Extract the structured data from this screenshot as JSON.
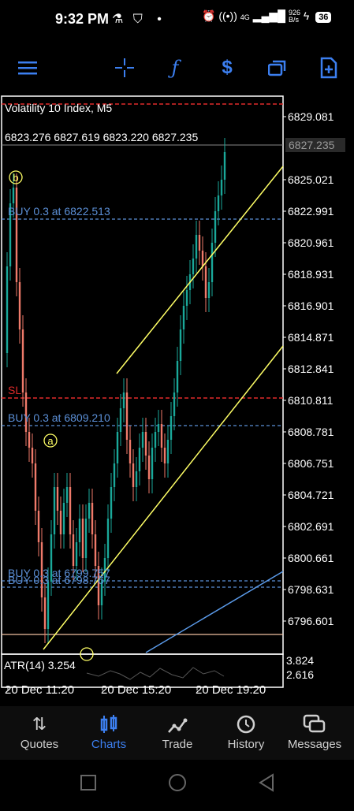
{
  "status_bar": {
    "time": "9:32 PM",
    "network_speed_value": "926",
    "network_speed_unit": "B/s",
    "network_type": "4G",
    "battery": "36"
  },
  "toolbar": {
    "icons": [
      "menu-icon",
      "crosshair-icon",
      "indicators-icon",
      "symbols-icon",
      "windows-icon",
      "new-order-icon"
    ],
    "accent_color": "#3c7ff0"
  },
  "chart": {
    "symbol_title": "Volatility 10 Index, M5",
    "ohlc": "6823.276 6827.619 6823.220 6827.235",
    "current_price": "6827.235",
    "price_labels": [
      "6829.081",
      "6827.235",
      "6825.021",
      "6822.991",
      "6820.961",
      "6818.931",
      "6816.901",
      "6814.871",
      "6812.841",
      "6810.811",
      "6808.781",
      "6806.751",
      "6804.721",
      "6802.691",
      "6800.661",
      "6798.631",
      "6796.601"
    ],
    "order_lines": [
      {
        "text": "BUY 0.3 at 6822.513",
        "color": "#5b8fd6"
      },
      {
        "text": "SL",
        "color": "#e02a2a"
      },
      {
        "text": "BUY 0.3 at 6809.210",
        "color": "#5b8fd6"
      },
      {
        "text": "BUY 0.3 at 6799.757",
        "color": "#5b8fd6"
      },
      {
        "text": "BUY 0.3 at 6798.767",
        "color": "#5b8fd6"
      }
    ],
    "wave_labels": [
      "b",
      "a"
    ],
    "indicator": {
      "label": "ATR(14) 3.254",
      "scale_top": "3.824",
      "scale_bottom": "2.616"
    },
    "date_labels": [
      "20 Dec 11:20",
      "20 Dec 15:20",
      "20 Dec 19:20"
    ],
    "colors": {
      "bull": "#1aa89a",
      "bear": "#ef7a6a",
      "channel": "#ffff66",
      "sl": "#e02a2a"
    }
  },
  "bottom_nav": {
    "items": [
      {
        "label": "Quotes",
        "icon": "quotes-icon"
      },
      {
        "label": "Charts",
        "icon": "charts-icon"
      },
      {
        "label": "Trade",
        "icon": "trade-icon"
      },
      {
        "label": "History",
        "icon": "history-icon"
      },
      {
        "label": "Messages",
        "icon": "messages-icon"
      }
    ],
    "active": "Charts"
  },
  "system_nav": [
    "recents-icon",
    "home-icon",
    "back-icon"
  ]
}
